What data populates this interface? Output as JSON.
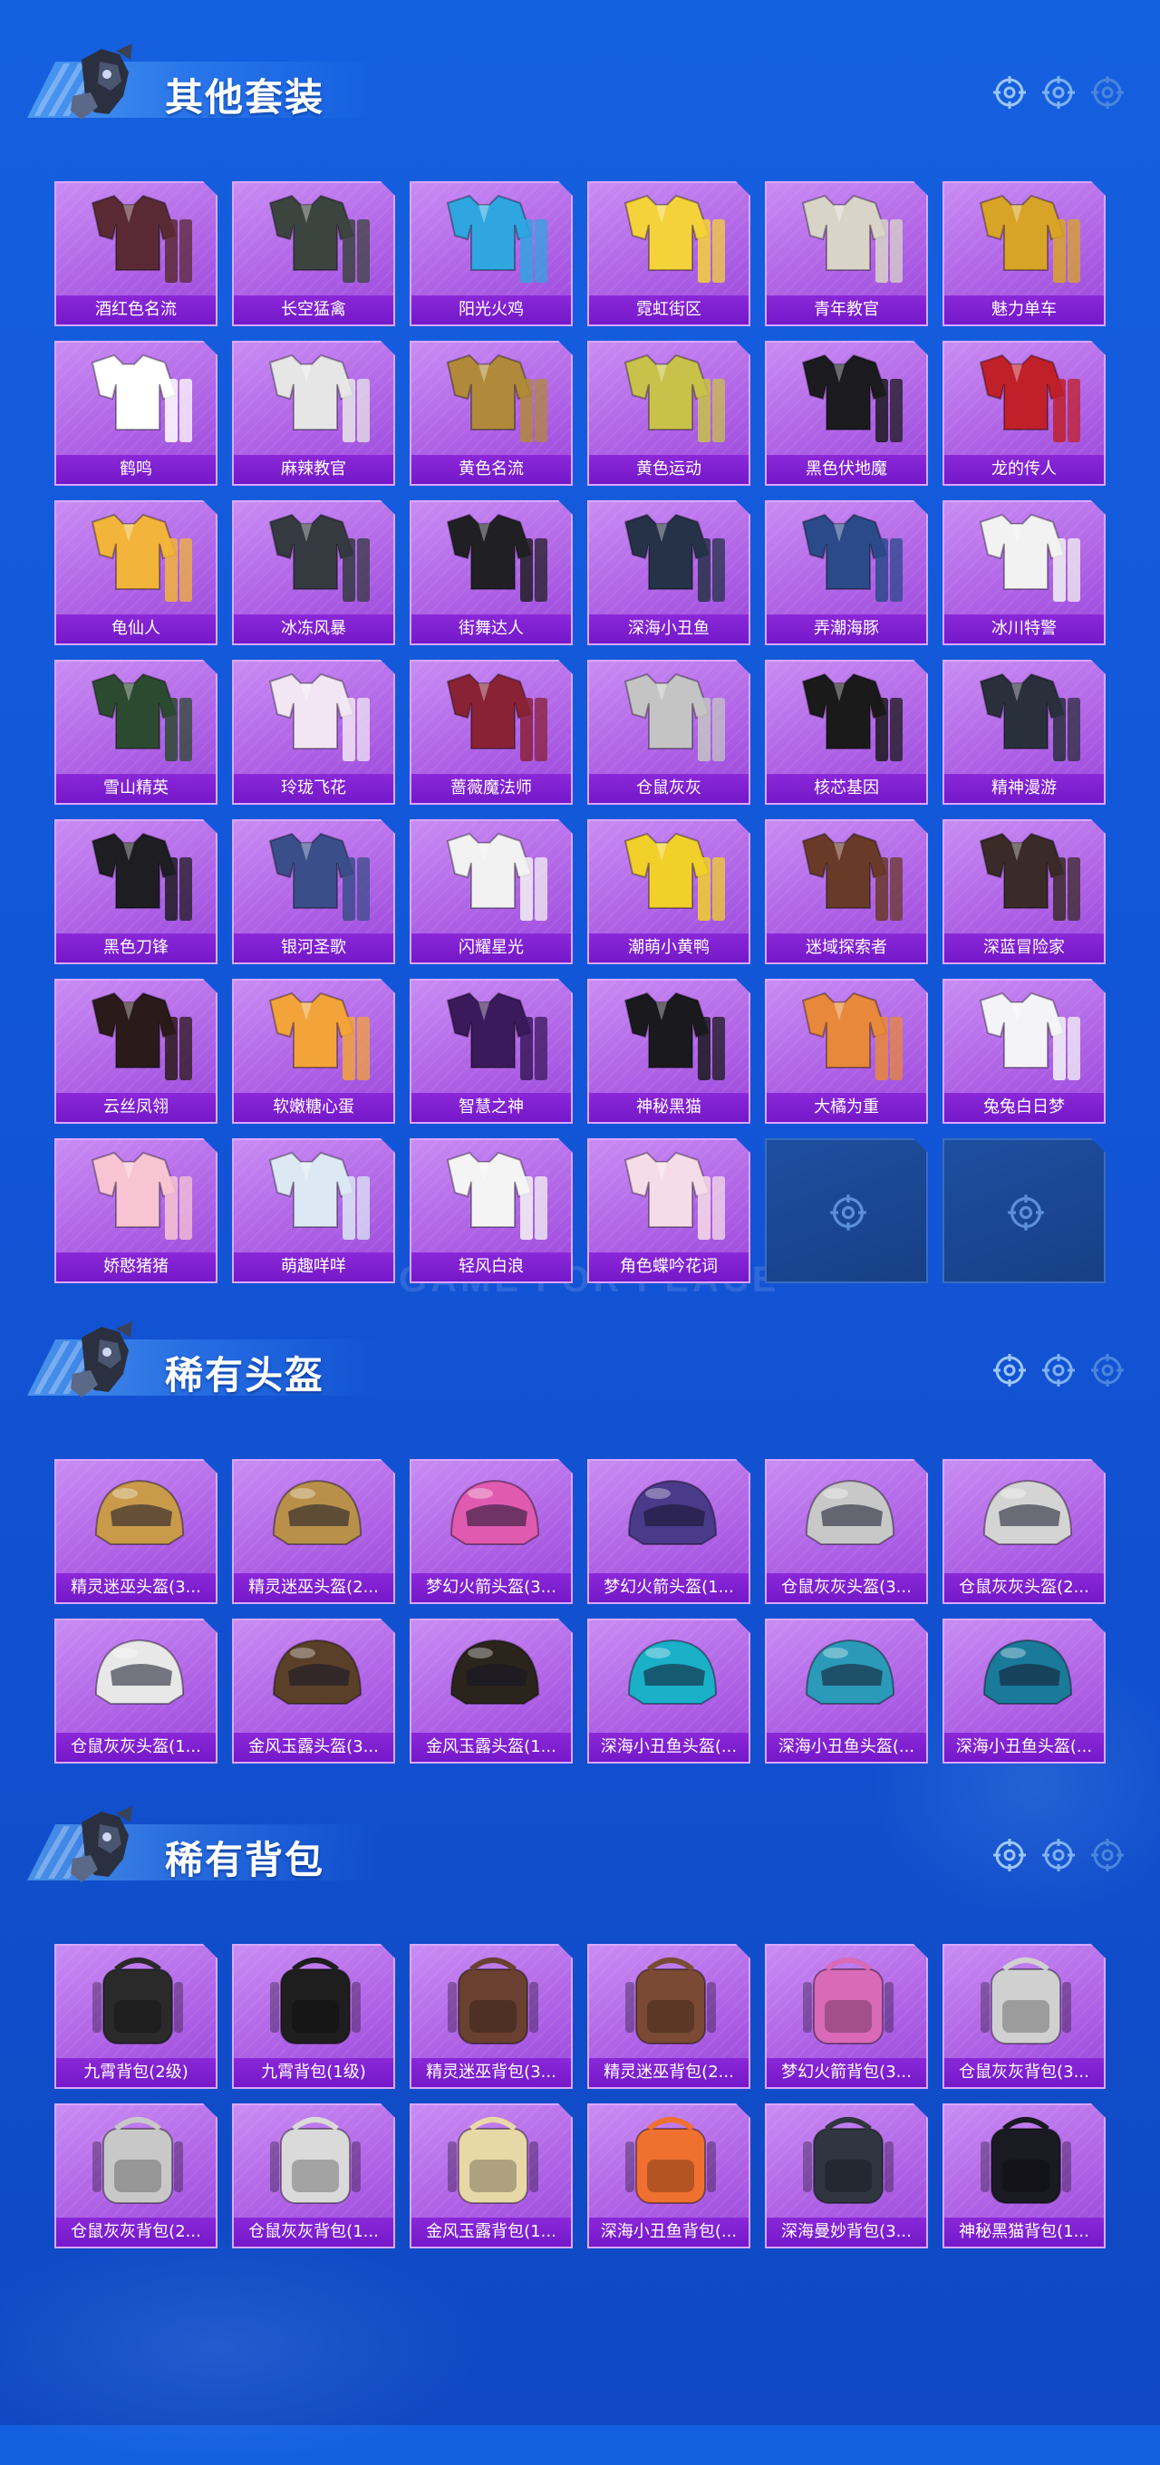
{
  "colors": {
    "accent": "#b46ae8",
    "label_bg": "#7c1ccd",
    "background": "#1256d8"
  },
  "watermark": "GAME FOR PEACE",
  "sections": [
    {
      "title": "其他套装",
      "items": [
        {
          "label": "酒红色名流",
          "icon": "outfit-icon",
          "tone": "#5a2a34"
        },
        {
          "label": "长空猛禽",
          "icon": "outfit-icon",
          "tone": "#3c4440"
        },
        {
          "label": "阳光火鸡",
          "icon": "outfit-icon",
          "tone": "#2fa6e0"
        },
        {
          "label": "霓虹街区",
          "icon": "outfit-icon",
          "tone": "#f4d23a"
        },
        {
          "label": "青年教官",
          "icon": "outfit-icon",
          "tone": "#d9d4c8"
        },
        {
          "label": "魅力单车",
          "icon": "outfit-icon",
          "tone": "#d8a428"
        },
        {
          "label": "鹤鸣",
          "icon": "outfit-icon",
          "tone": "#ffffff"
        },
        {
          "label": "麻辣教官",
          "icon": "outfit-icon",
          "tone": "#e6e6e6"
        },
        {
          "label": "黄色名流",
          "icon": "outfit-icon",
          "tone": "#b08a3a"
        },
        {
          "label": "黄色运动",
          "icon": "outfit-icon",
          "tone": "#c8c24a"
        },
        {
          "label": "黑色伏地魔",
          "icon": "outfit-icon",
          "tone": "#1b1b1f"
        },
        {
          "label": "龙的传人",
          "icon": "outfit-icon",
          "tone": "#c0202a"
        },
        {
          "label": "龟仙人",
          "icon": "outfit-icon",
          "tone": "#f2b43a"
        },
        {
          "label": "冰冻风暴",
          "icon": "outfit-icon",
          "tone": "#343a40"
        },
        {
          "label": "街舞达人",
          "icon": "outfit-icon",
          "tone": "#202024"
        },
        {
          "label": "深海小丑鱼",
          "icon": "outfit-icon",
          "tone": "#263248"
        },
        {
          "label": "弄潮海豚",
          "icon": "outfit-icon",
          "tone": "#2a4a8a"
        },
        {
          "label": "冰川特警",
          "icon": "outfit-icon",
          "tone": "#f2f2f2"
        },
        {
          "label": "雪山精英",
          "icon": "outfit-icon",
          "tone": "#2c4a30"
        },
        {
          "label": "玲珑飞花",
          "icon": "outfit-icon",
          "tone": "#f2e6f4"
        },
        {
          "label": "蔷薇魔法师",
          "icon": "outfit-icon",
          "tone": "#8a2236"
        },
        {
          "label": "仓鼠灰灰",
          "icon": "outfit-icon",
          "tone": "#c4c4c4"
        },
        {
          "label": "核芯基因",
          "icon": "outfit-icon",
          "tone": "#1a1a1a"
        },
        {
          "label": "精神漫游",
          "icon": "outfit-icon",
          "tone": "#2a2f3c"
        },
        {
          "label": "黑色刀锋",
          "icon": "outfit-icon",
          "tone": "#1d1d22"
        },
        {
          "label": "银河圣歌",
          "icon": "outfit-icon",
          "tone": "#3a4e8a"
        },
        {
          "label": "闪耀星光",
          "icon": "outfit-icon",
          "tone": "#f2f2f2"
        },
        {
          "label": "潮萌小黄鸭",
          "icon": "outfit-icon",
          "tone": "#f2d02a"
        },
        {
          "label": "迷域探索者",
          "icon": "outfit-icon",
          "tone": "#6a3a28"
        },
        {
          "label": "深蓝冒险家",
          "icon": "outfit-icon",
          "tone": "#3a2a28"
        },
        {
          "label": "云丝凤翎",
          "icon": "outfit-icon",
          "tone": "#2a1a1a"
        },
        {
          "label": "软嫩糖心蛋",
          "icon": "outfit-icon",
          "tone": "#f2a43a"
        },
        {
          "label": "智慧之神",
          "icon": "outfit-icon",
          "tone": "#3a1a5a"
        },
        {
          "label": "神秘黑猫",
          "icon": "outfit-icon",
          "tone": "#1a1a1e"
        },
        {
          "label": "大橘为重",
          "icon": "outfit-icon",
          "tone": "#e8883a"
        },
        {
          "label": "兔兔白日梦",
          "icon": "outfit-icon",
          "tone": "#f4f4f8"
        },
        {
          "label": "娇憨猪猪",
          "icon": "outfit-icon",
          "tone": "#f8c4d4"
        },
        {
          "label": "萌趣咩咩",
          "icon": "outfit-icon",
          "tone": "#dce8f4"
        },
        {
          "label": "轻风白浪",
          "icon": "outfit-icon",
          "tone": "#f4f4f4"
        },
        {
          "label": "角色蝶吟花词",
          "icon": "outfit-icon",
          "tone": "#f6dce8"
        }
      ],
      "empty_slots": 2
    },
    {
      "title": "稀有头盔",
      "items": [
        {
          "label": "精灵迷巫头盔(3...",
          "icon": "helmet-icon",
          "tone": "#c89a4a"
        },
        {
          "label": "精灵迷巫头盔(2...",
          "icon": "helmet-icon",
          "tone": "#b8904a"
        },
        {
          "label": "梦幻火箭头盔(3...",
          "icon": "helmet-icon",
          "tone": "#e05ab0"
        },
        {
          "label": "梦幻火箭头盔(1...",
          "icon": "helmet-icon",
          "tone": "#4a3a8a"
        },
        {
          "label": "仓鼠灰灰头盔(3...",
          "icon": "helmet-icon",
          "tone": "#c8c8c8"
        },
        {
          "label": "仓鼠灰灰头盔(2...",
          "icon": "helmet-icon",
          "tone": "#d4d4d4"
        },
        {
          "label": "仓鼠灰灰头盔(1...",
          "icon": "helmet-icon",
          "tone": "#e8e8e8"
        },
        {
          "label": "金风玉露头盔(3...",
          "icon": "helmet-icon",
          "tone": "#5a4028"
        },
        {
          "label": "金风玉露头盔(1...",
          "icon": "helmet-icon",
          "tone": "#2a241c"
        },
        {
          "label": "深海小丑鱼头盔(...",
          "icon": "helmet-icon",
          "tone": "#1ab0c8"
        },
        {
          "label": "深海小丑鱼头盔(...",
          "icon": "helmet-icon",
          "tone": "#2a9ab8"
        },
        {
          "label": "深海小丑鱼头盔(...",
          "icon": "helmet-icon",
          "tone": "#1a7a9a"
        }
      ],
      "empty_slots": 0
    },
    {
      "title": "稀有背包",
      "items": [
        {
          "label": "九霄背包(2级)",
          "icon": "backpack-icon",
          "tone": "#2a2a2a"
        },
        {
          "label": "九霄背包(1级)",
          "icon": "backpack-icon",
          "tone": "#1e1e1e"
        },
        {
          "label": "精灵迷巫背包(3...",
          "icon": "backpack-icon",
          "tone": "#6a4030"
        },
        {
          "label": "精灵迷巫背包(2...",
          "icon": "backpack-icon",
          "tone": "#7a4a34"
        },
        {
          "label": "梦幻火箭背包(3...",
          "icon": "backpack-icon",
          "tone": "#d86ab8"
        },
        {
          "label": "仓鼠灰灰背包(3...",
          "icon": "backpack-icon",
          "tone": "#d0d0d0"
        },
        {
          "label": "仓鼠灰灰背包(2...",
          "icon": "backpack-icon",
          "tone": "#c8c8c8"
        },
        {
          "label": "仓鼠灰灰背包(1...",
          "icon": "backpack-icon",
          "tone": "#dadada"
        },
        {
          "label": "金风玉露背包(1...",
          "icon": "backpack-icon",
          "tone": "#e8d8a8"
        },
        {
          "label": "深海小丑鱼背包(...",
          "icon": "backpack-icon",
          "tone": "#f07030"
        },
        {
          "label": "深海曼妙背包(3...",
          "icon": "backpack-icon",
          "tone": "#303640"
        },
        {
          "label": "神秘黑猫背包(1...",
          "icon": "backpack-icon",
          "tone": "#1a1a22"
        }
      ],
      "empty_slots": 0
    }
  ]
}
